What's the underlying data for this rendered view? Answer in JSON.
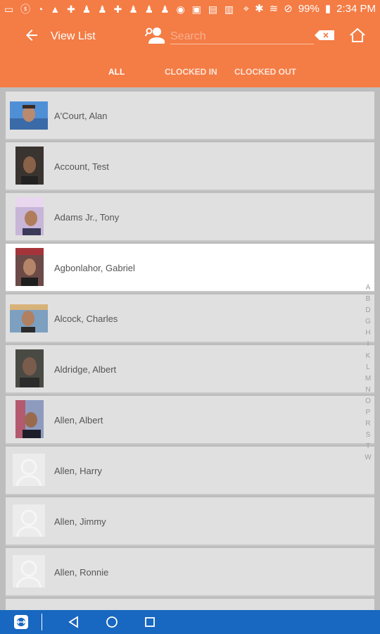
{
  "status": {
    "battery": "99%",
    "time": "2:34 PM"
  },
  "appbar": {
    "title": "View List",
    "search_placeholder": "Search"
  },
  "tabs": [
    {
      "label": "ALL"
    },
    {
      "label": "CLOCKED IN"
    },
    {
      "label": "CLOCKED OUT"
    }
  ],
  "employees": [
    {
      "name": "A'Court, Alan"
    },
    {
      "name": "Account, Test"
    },
    {
      "name": "Adams Jr., Tony"
    },
    {
      "name": "Agbonlahor, Gabriel"
    },
    {
      "name": "Alcock, Charles"
    },
    {
      "name": "Aldridge, Albert"
    },
    {
      "name": "Allen, Albert"
    },
    {
      "name": "Allen, Harry"
    },
    {
      "name": "Allen, Jimmy"
    },
    {
      "name": "Allen, Ronnie"
    }
  ],
  "alphabet": [
    "A",
    "B",
    "D",
    "G",
    "H",
    "I",
    "K",
    "L",
    "M",
    "N",
    "O",
    "P",
    "R",
    "S",
    "T",
    "W"
  ],
  "colors": {
    "accent": "#f47c45",
    "nav": "#1867c0",
    "row_bg": "#e0e0e0",
    "selected_bg": "#ffffff"
  }
}
